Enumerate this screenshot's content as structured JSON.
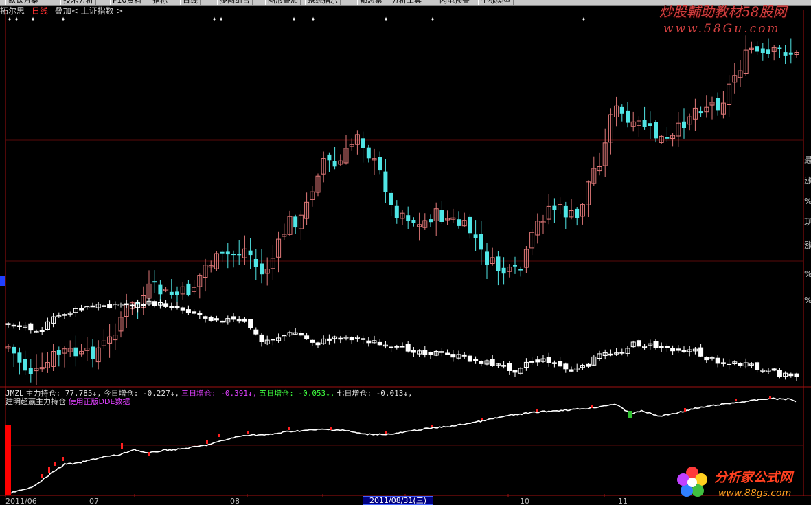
{
  "toolbar": {
    "items": [
      "默认方案",
      "技术分析",
      "F10资料",
      "指标",
      "日线",
      "多图组合",
      "图形叠加",
      "系统指示",
      "都怎票",
      "分析工具",
      "闪电预警",
      "坐标类型"
    ]
  },
  "stock": {
    "name": "拓尔思",
    "period": "日线",
    "overlay": "叠加< 上证指数 >"
  },
  "colors": {
    "up": "#e07878",
    "down": "#50e6e6",
    "bg": "#000000",
    "panel_border": "#a01010",
    "line": "#ffffff"
  },
  "indicator": {
    "line1": [
      {
        "text": "JMZL",
        "color": "white"
      },
      {
        "text": "主力持仓: 77.785↓,",
        "color": "white"
      },
      {
        "text": "今日增仓: -0.227↓,",
        "color": "white"
      },
      {
        "text": "三日增仓: -0.391↓,",
        "color": "magenta"
      },
      {
        "text": "五日增仓: -0.053↓,",
        "color": "green"
      },
      {
        "text": "七日增仓: -0.013↓,",
        "color": "white"
      }
    ],
    "line2_name": "建明超赢主力持仓",
    "line2_note": "使用正版DDE数据"
  },
  "xaxis": {
    "labels": [
      "2011/06",
      "07",
      "08",
      "10",
      "11"
    ],
    "highlight": "2011/08/31(三)"
  },
  "right_axis": [
    "最",
    "涨",
    "%",
    "现",
    "涨",
    "%",
    "%"
  ],
  "watermark": {
    "line1": "炒股輔助教材58股网",
    "line2": "www.58Gu.com"
  },
  "logo": {
    "text1": "分析家公式网",
    "text2": "www.88gs.com"
  }
}
